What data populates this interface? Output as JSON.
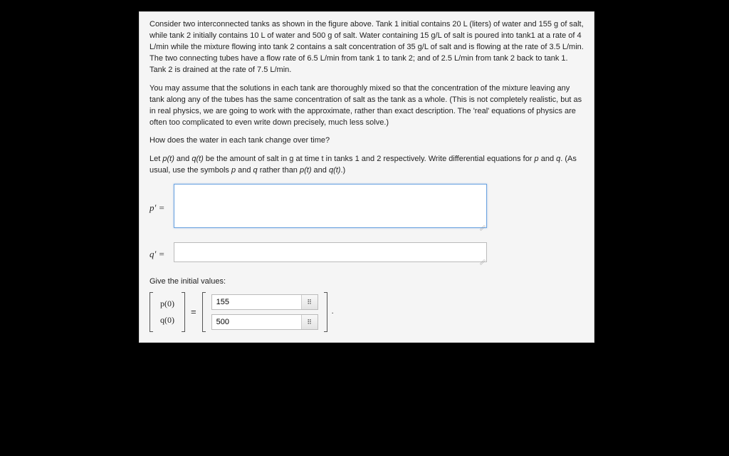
{
  "problem": {
    "para1": "Consider two interconnected tanks as shown in the figure above. Tank 1 initial contains 20 L (liters) of water and 155 g of salt, while tank 2 initially contains 10 L of water and 500 g of salt. Water containing 15 g/L of salt is poured into tank1 at a rate of 4 L/min while the mixture flowing into tank 2 contains a salt concentration of 35 g/L of salt and is flowing at the rate of 3.5 L/min. The two connecting tubes have a flow rate of 6.5 L/min from tank 1 to tank 2; and of 2.5 L/min from tank 2 back to tank 1. Tank 2 is drained at the rate of 7.5 L/min.",
    "para2": "You may assume that the solutions in each tank are thoroughly mixed so that the concentration of the mixture leaving any tank along any of the tubes has the same concentration of salt as the tank as a whole. (This is not completely realistic, but as in real physics, we are going to work with the approximate, rather than exact description. The 'real' equations of physics are often too complicated to even write down precisely, much less solve.)",
    "para3": "How does the water in each tank change over time?",
    "para4_a": "Let ",
    "para4_b": " and ",
    "para4_c": " be the amount of salt in g at time t in tanks 1 and 2 respectively. Write differential equations for ",
    "para4_d": " and ",
    "para4_e": ". (As usual, use the symbols ",
    "para4_f": " and ",
    "para4_g": " rather than ",
    "para4_h": " and ",
    "para4_i": ".)",
    "pt": "p(t)",
    "qt": "q(t)",
    "p": "p",
    "q": "q"
  },
  "eqs": {
    "p_label": "p′  =",
    "q_label": "q′  =",
    "p_value": "",
    "q_value": ""
  },
  "initial": {
    "section_label": "Give the initial values:",
    "row1_label": "p(0)",
    "row2_label": "q(0)",
    "eq": "=",
    "v1": "155",
    "v2": "500",
    "period": "."
  },
  "icons": {
    "keypad_glyph": "⠿"
  }
}
